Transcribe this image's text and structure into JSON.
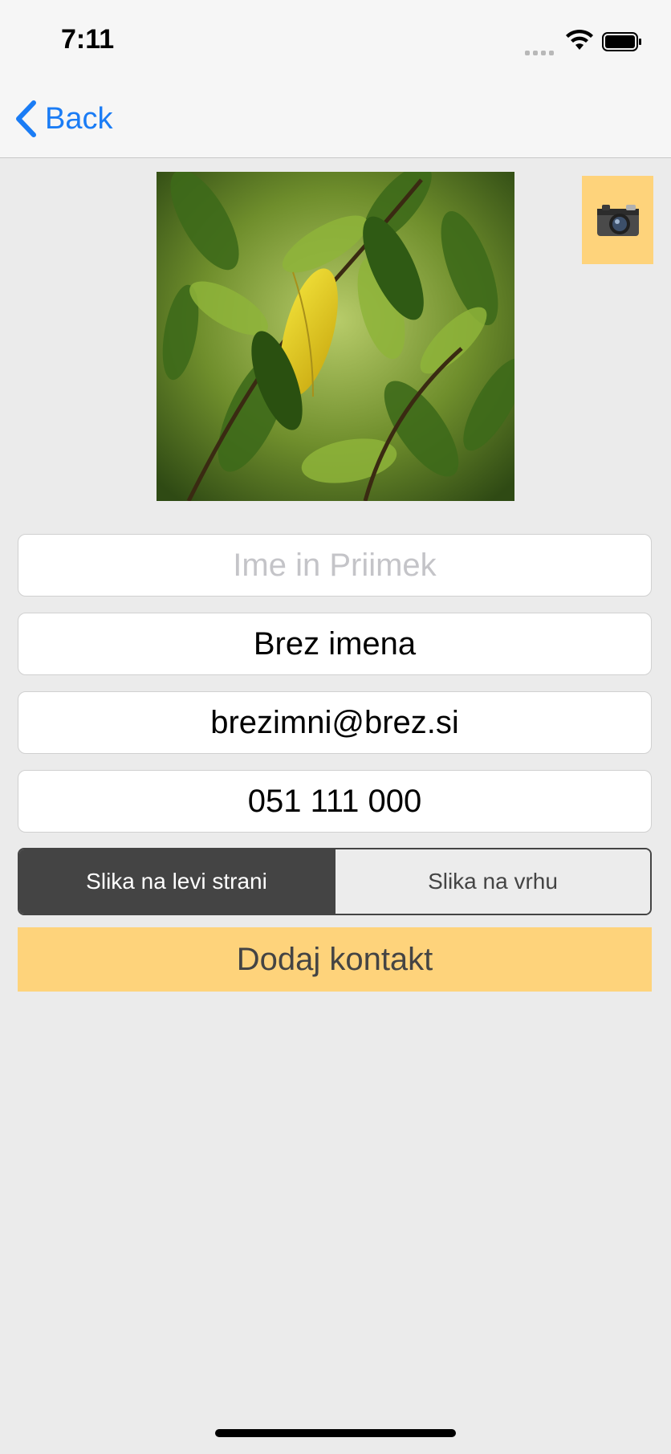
{
  "status_bar": {
    "time": "7:11"
  },
  "nav": {
    "back_label": "Back"
  },
  "photo": {
    "description_icon": "plant-leaf-photo"
  },
  "camera": {
    "icon": "camera-icon",
    "accent": "#fed37b"
  },
  "form": {
    "name_placeholder": "Ime in Priimek",
    "nickname_value": "Brez imena",
    "email_value": "brezimni@brez.si",
    "phone_value": "051 111 000"
  },
  "layout_toggle": {
    "options": [
      "Slika na levi strani",
      "Slika na vrhu"
    ],
    "selected_index": 0
  },
  "actions": {
    "add_contact_label": "Dodaj kontakt"
  },
  "colors": {
    "accent": "#fed37b",
    "link": "#1a7cf5",
    "segment_dark": "#444444"
  }
}
